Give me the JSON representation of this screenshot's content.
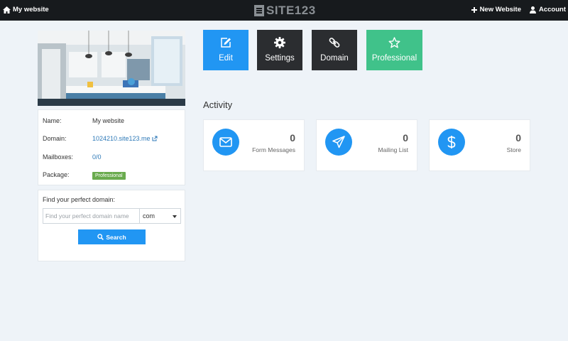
{
  "topbar": {
    "site_label": "My website",
    "logo_text": "SITE123",
    "new_website_label": "New Website",
    "account_label": "Account"
  },
  "info": {
    "name_label": "Name:",
    "name_value": "My website",
    "domain_label": "Domain:",
    "domain_value": "1024210.site123.me",
    "mailboxes_label": "Mailboxes:",
    "mailboxes_value": "0/0",
    "package_label": "Package:",
    "package_value": "Professional"
  },
  "domain_search": {
    "title": "Find your perfect domain:",
    "placeholder": "Find your perfect domain name",
    "value": "",
    "tld": "com",
    "search_label": "Search"
  },
  "tiles": [
    {
      "label": "Edit",
      "color": "#2196f3",
      "icon": "edit-icon"
    },
    {
      "label": "Settings",
      "color": "#2b2d30",
      "icon": "gear-icon"
    },
    {
      "label": "Domain",
      "color": "#2b2d30",
      "icon": "link-icon"
    },
    {
      "label": "Professional",
      "color": "#40c28a",
      "icon": "star-icon"
    }
  ],
  "activity": {
    "title": "Activity",
    "cards": [
      {
        "count": "0",
        "label": "Form Messages",
        "icon": "envelope-icon"
      },
      {
        "count": "0",
        "label": "Mailing List",
        "icon": "paper-plane-icon"
      },
      {
        "count": "0",
        "label": "Store",
        "icon": "dollar-icon"
      }
    ]
  },
  "colors": {
    "accent": "#2196f3",
    "dark_tile": "#2b2d30",
    "pro_tile": "#40c28a",
    "badge": "#6aab4e",
    "topbar": "#171a1d"
  }
}
